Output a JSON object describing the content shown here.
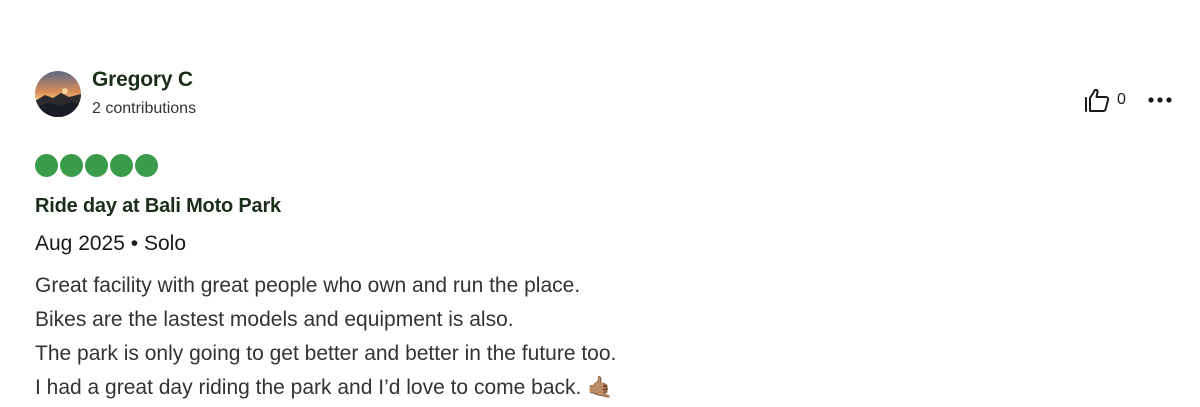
{
  "review": {
    "user": {
      "name": "Gregory C",
      "contributions": "2 contributions",
      "avatar": "avatar-photo"
    },
    "helpful": {
      "icon": "thumbs-up-icon",
      "count": "0"
    },
    "more_menu": {
      "icon": "more-horizontal-icon"
    },
    "rating": {
      "value": 5,
      "max": 5,
      "color": "#3a9b4a"
    },
    "title": "Ride day at Bali Moto Park",
    "trip": {
      "date": "Aug 2025",
      "separator": "•",
      "type": "Solo"
    },
    "body": [
      "Great facility with great people who own and run the place.",
      "Bikes are the lastest models and equipment is also.",
      "The park is only going to get better and better in the future too.",
      "I had a great day riding the park and I’d love to come back. 🤙🏽"
    ]
  }
}
